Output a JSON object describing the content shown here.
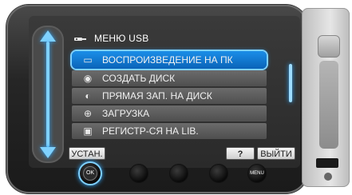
{
  "menu": {
    "title": "МЕНЮ USB",
    "items": [
      {
        "label": "ВОСПРОИЗВЕДЕНИЕ НА ПК",
        "selected": true,
        "icon": "playback-pc-icon"
      },
      {
        "label": "СОЗДАТЬ ДИСК",
        "selected": false,
        "icon": "create-disc-icon"
      },
      {
        "label": "ПРЯМАЯ ЗАП. НА ДИСК",
        "selected": false,
        "icon": "direct-disc-icon"
      },
      {
        "label": "ЗАГРУЗКА",
        "selected": false,
        "icon": "upload-globe-icon"
      },
      {
        "label": "РЕГИСТР-СЯ НА LIB.",
        "selected": false,
        "icon": "lib-register-icon"
      }
    ]
  },
  "bottom_bar": {
    "setup_label": "УСТАН.",
    "help_label": "?",
    "exit_label": "ВЫЙТИ"
  },
  "hardware": {
    "ok_label": "OK",
    "menu_label": "MENU"
  },
  "colors": {
    "accent": "#2fa8ff",
    "selected_bg": "#0a63b8"
  }
}
